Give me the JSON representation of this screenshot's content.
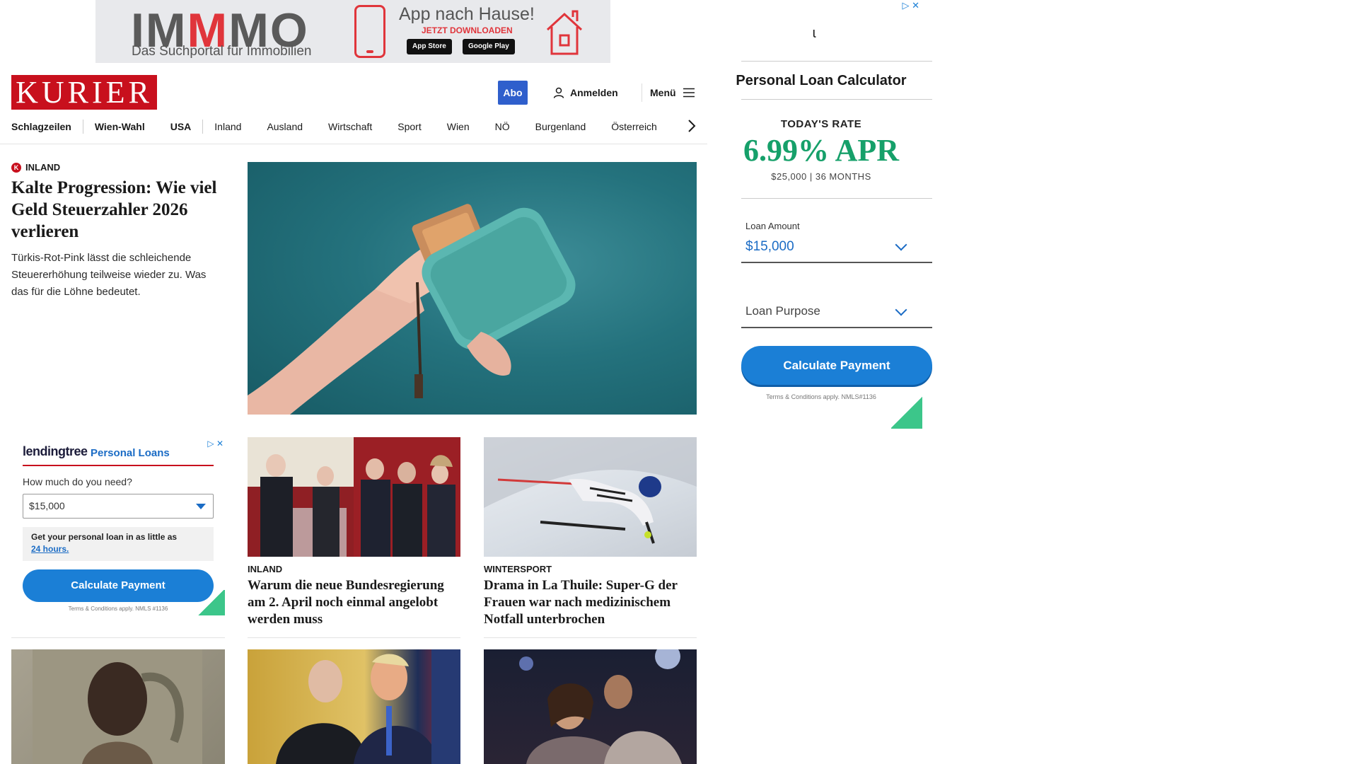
{
  "top_ad": {
    "brand_prefix": "IM",
    "brand_red": "M",
    "brand_suffix": "MO",
    "tagline": "Das Suchportal für Immobilien",
    "app_title": "App nach Hause!",
    "cta": "JETZT DOWNLOADEN",
    "app_store": "App Store",
    "google_play": "Google Play"
  },
  "header": {
    "logo": "KURIER",
    "abo": "Abo",
    "login": "Anmelden",
    "menu": "Menü"
  },
  "nav": {
    "items": [
      "Schlagzeilen",
      "Wien-Wahl",
      "USA",
      "Inland",
      "Ausland",
      "Wirtschaft",
      "Sport",
      "Wien",
      "NÖ",
      "Burgenland",
      "Österreich"
    ]
  },
  "lead": {
    "kicker": "INLAND",
    "title": "Kalte Progression: Wie viel Geld Steuerzahler 2026 verlieren",
    "teaser": "Türkis-Rot-Pink lässt die schleichende Steuererhöhung teilweise wieder zu. Was das für die Löhne bedeutet."
  },
  "cards": [
    {
      "kicker": "INLAND",
      "title": "Warum die neue Bundesregierung am 2. April noch einmal angelobt werden muss"
    },
    {
      "kicker": "WINTERSPORT",
      "title": "Drama in La Thuile: Super-G der Frauen war nach medizinischem Notfall unterbrochen"
    }
  ],
  "left_ad": {
    "logo": "lendingtree",
    "product": "Personal Loans",
    "question": "How much do you need?",
    "amount": "$15,000",
    "promo_text": "Get your personal loan in as little as",
    "promo_link": "24 hours.",
    "button": "Calculate Payment",
    "terms": "Terms & Conditions apply. NMLS #1136"
  },
  "right_ad": {
    "title": "Personal Loan Calculator",
    "today_label": "TODAY'S RATE",
    "rate": "6.99% APR",
    "rate_terms": "$25,000 | 36 MONTHS",
    "amount_label": "Loan Amount",
    "amount_value": "$15,000",
    "purpose_placeholder": "Loan Purpose",
    "button": "Calculate Payment",
    "terms": "Terms & Conditions apply. NMLS#1136"
  },
  "colors": {
    "brand_red": "#c8101d",
    "abo_blue": "#2f5fcc",
    "ad_blue": "#1b7fd6",
    "rate_green": "#16a06a"
  }
}
